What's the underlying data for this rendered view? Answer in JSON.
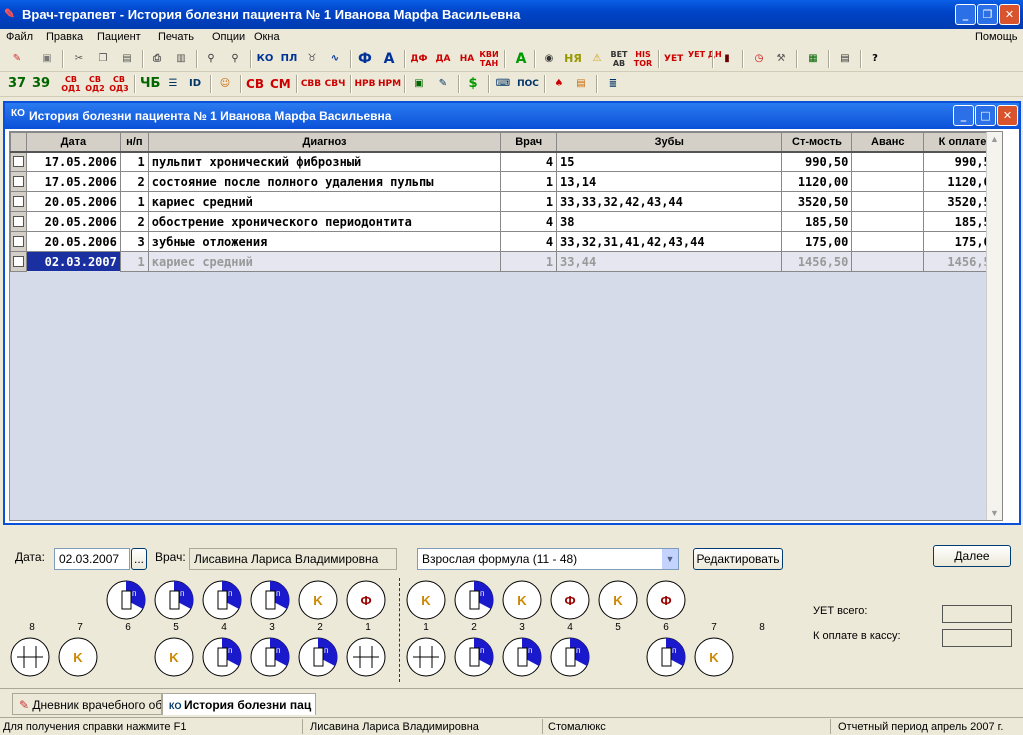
{
  "window": {
    "title": "Врач-терапевт - История болезни пациента № 1 Иванова Марфа Васильевна"
  },
  "menu": [
    "Файл",
    "Правка",
    "Пациент",
    "Печать",
    "Опции",
    "Окна"
  ],
  "menu_help": "Помощь",
  "toolbar1": [
    "ДФ",
    "ДА",
    "НА",
    "КВИ ТАН",
    "НЯ",
    "ВЕТ АВ",
    "HIS TOR",
    "УЕТ",
    "УЕТ ДН"
  ],
  "toolbar2": [
    "37",
    "39",
    "СВ ОД1",
    "СВ ОД2",
    "СВ ОД3",
    "ЧБ",
    "СВ",
    "СМ",
    "СВВ",
    "СВЧ",
    "НРВ",
    "НРМ",
    "ПОС"
  ],
  "child": {
    "title": "История болезни пациента № 1 Иванова Марфа Васильевна"
  },
  "table": {
    "headers": [
      "Дата",
      "н/п",
      "Диагноз",
      "Врач",
      "Зубы",
      "Ст-мость",
      "Аванс",
      "К оплате"
    ],
    "rows": [
      [
        "17.05.2006",
        "1",
        "пульпит хронический фиброзный",
        "4",
        "15",
        "990,50",
        "",
        "990,50"
      ],
      [
        "17.05.2006",
        "2",
        "состояние после полного удаления пульпы",
        "1",
        "13,14",
        "1120,00",
        "",
        "1120,00"
      ],
      [
        "20.05.2006",
        "1",
        "кариес средний",
        "1",
        "33,33,32,42,43,44",
        "3520,50",
        "",
        "3520,50"
      ],
      [
        "20.05.2006",
        "2",
        "обострение хронического периодонтита",
        "4",
        "38",
        "185,50",
        "",
        "185,50"
      ],
      [
        "20.05.2006",
        "3",
        "зубные отложения",
        "4",
        "33,32,31,41,42,43,44",
        "175,00",
        "",
        "175,00"
      ],
      [
        "02.03.2007",
        "1",
        "кариес средний",
        "1",
        "33,44",
        "1456,50",
        "",
        "1456,50"
      ]
    ]
  },
  "panel": {
    "date_label": "Дата:",
    "date_value": "02.03.2007",
    "date_btn": "...",
    "doctor_label": "Врач:",
    "doctor_value": "Лисавина Лариса Владимировна",
    "formula_value": "Взрослая формула (11 - 48)",
    "edit_btn": "Редактировать",
    "next_btn": "Далее",
    "uet_label": "УЕТ всего:",
    "pay_label": "К оплате в кассу:"
  },
  "teeth": {
    "upper_marks": [
      "P",
      "P",
      "P",
      "P",
      "K",
      "Ф",
      "K",
      "P",
      "K",
      "Ф",
      "K",
      "Ф"
    ],
    "left_nums": [
      "8",
      "7",
      "6",
      "5",
      "4",
      "3",
      "2",
      "1"
    ],
    "right_nums": [
      "1",
      "2",
      "3",
      "4",
      "5",
      "6",
      "7",
      "8"
    ],
    "lower_marks": [
      "",
      "K",
      "K",
      "P",
      "P",
      "P",
      "",
      "",
      "P",
      "P",
      "P",
      "P",
      "K"
    ]
  },
  "taskbar": {
    "tab1": "Дневник врачебного обс",
    "tab2": "История болезни пац"
  },
  "status": {
    "help": "Для получения справки нажмите F1",
    "user": "Лисавина Лариса Владимировна",
    "app": "Стомалюкс",
    "period": "Отчетный период апрель 2007 г."
  },
  "colors": {
    "title": "#0a5fe6",
    "fill": "#1a1acc",
    "k": "#cc8800",
    "f": "#990000"
  }
}
